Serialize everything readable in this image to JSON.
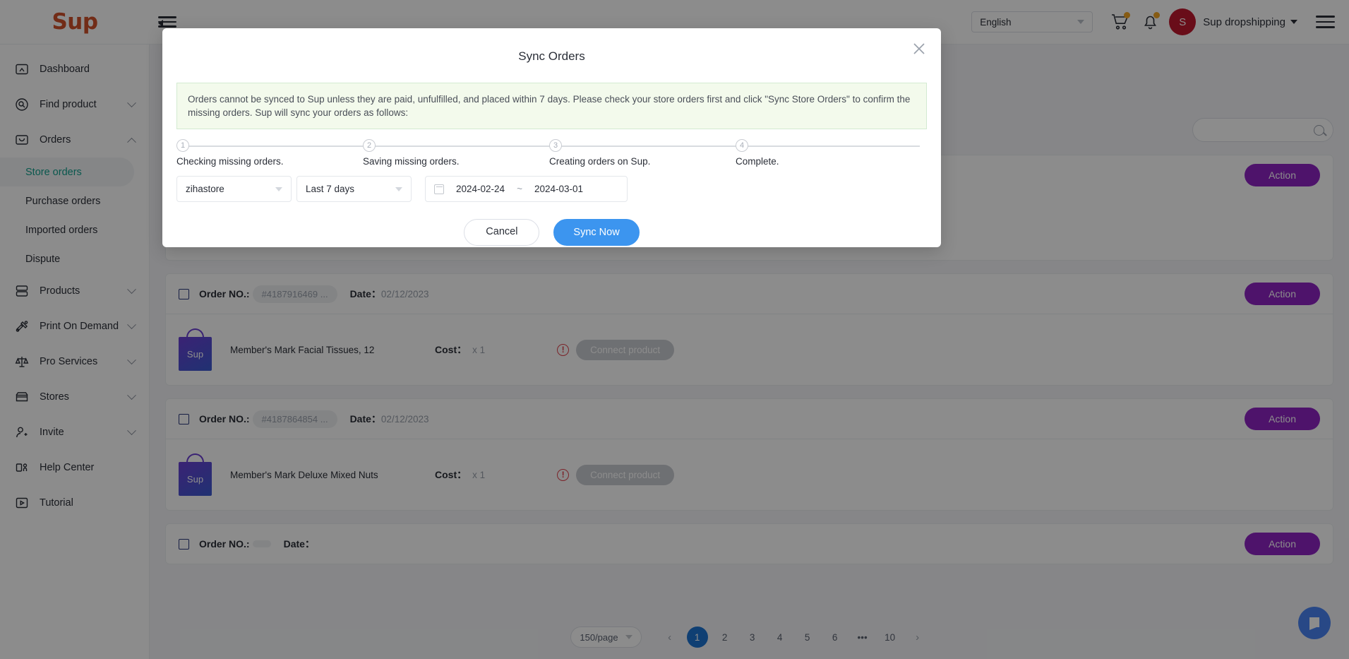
{
  "header": {
    "logo": "Sup",
    "collapse_icon": "sidebar-collapse-icon",
    "language": "English",
    "cart_icon": "cart-icon",
    "bell_icon": "bell-icon",
    "avatar_initial": "S",
    "account_name": "Sup dropshipping",
    "menu_icon": "hamburger-menu-icon"
  },
  "sidebar": {
    "items": [
      {
        "label": "Dashboard",
        "icon": "dashboard-icon",
        "expandable": false
      },
      {
        "label": "Find product",
        "icon": "search-product-icon",
        "expandable": true,
        "expanded": false
      },
      {
        "label": "Orders",
        "icon": "orders-box-icon",
        "expandable": true,
        "expanded": true
      },
      {
        "label": "Products",
        "icon": "products-stack-icon",
        "expandable": true,
        "expanded": false
      },
      {
        "label": "Print On Demand",
        "icon": "print-on-demand-icon",
        "expandable": true,
        "expanded": false
      },
      {
        "label": "Pro Services",
        "icon": "scales-icon",
        "expandable": true,
        "expanded": false
      },
      {
        "label": "Stores",
        "icon": "store-icon",
        "expandable": true,
        "expanded": false
      },
      {
        "label": "Invite",
        "icon": "user-add-icon",
        "expandable": true,
        "expanded": false
      },
      {
        "label": "Help Center",
        "icon": "help-center-icon",
        "expandable": false
      },
      {
        "label": "Tutorial",
        "icon": "tutorial-icon",
        "expandable": false
      }
    ],
    "orders_subitems": [
      {
        "label": "Store orders",
        "active": true
      },
      {
        "label": "Purchase orders",
        "active": false
      },
      {
        "label": "Imported orders",
        "active": false
      },
      {
        "label": "Dispute",
        "active": false
      }
    ]
  },
  "content": {
    "search_placeholder": "",
    "search_icon": "search-icon",
    "action_label": "Action",
    "order_no_label": "Order NO.:",
    "date_label": "Date：",
    "cost_label": "Cost：",
    "connect_label": "Connect product",
    "warn_icon": "warning-icon",
    "orders": [
      {
        "order_no": "#4187916469 ...",
        "date": "02/12/2023",
        "product": "Member's Mark Facial Tissues, 12",
        "cost": "x 1"
      },
      {
        "order_no": "#4187864854 ...",
        "date": "02/12/2023",
        "product": "Member's Mark Deluxe Mixed Nuts",
        "cost": "x 1"
      }
    ]
  },
  "pagination": {
    "page_size": "150/page",
    "prev_icon": "chevron-left-icon",
    "next_icon": "chevron-right-icon",
    "pages": [
      "1",
      "2",
      "3",
      "4",
      "5",
      "6",
      "•••",
      "10"
    ],
    "current": "1"
  },
  "chat": {
    "icon": "chat-bubble-icon"
  },
  "modal": {
    "title": "Sync Orders",
    "close_icon": "close-icon",
    "notice": "Orders cannot be synced to Sup unless they are paid, unfulfilled, and placed within 7 days. Please check your store orders first and click \"Sync Store Orders\" to confirm the missing orders. Sup will sync your orders as follows:",
    "steps": [
      {
        "num": "1",
        "text": "Checking missing orders."
      },
      {
        "num": "2",
        "text": "Saving missing orders."
      },
      {
        "num": "3",
        "text": "Creating orders on Sup."
      },
      {
        "num": "4",
        "text": "Complete."
      }
    ],
    "store_select": "zihastore",
    "range_select": "Last 7 days",
    "calendar_icon": "calendar-icon",
    "date_start": "2024-02-24",
    "date_separator": "~",
    "date_end": "2024-03-01",
    "cancel_label": "Cancel",
    "sync_label": "Sync Now"
  },
  "colors": {
    "brand_orange": "#d0502a",
    "active_teal": "#13a08e",
    "action_purple": "#8e24c4",
    "primary_blue": "#3c95ef",
    "page_blue": "#1c73d2",
    "avatar_red": "#c0182f",
    "notice_bg": "#f3faec",
    "notice_border": "#d3ead1",
    "chat_blue": "#4a84f5"
  }
}
